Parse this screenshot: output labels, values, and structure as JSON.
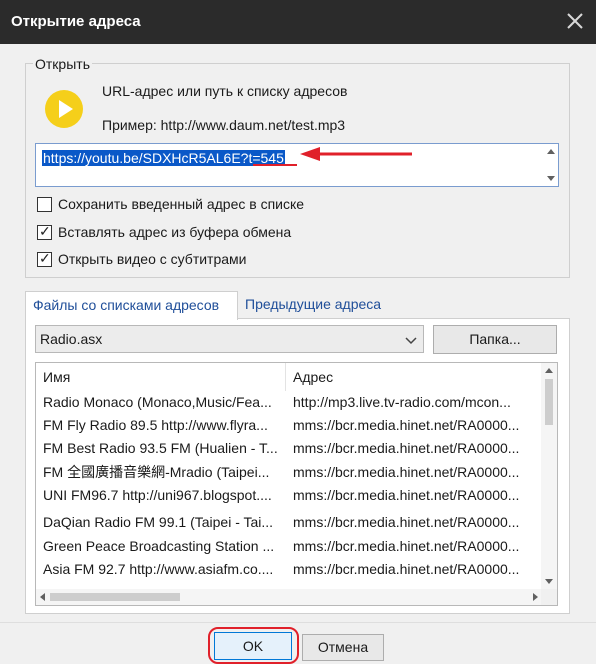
{
  "window": {
    "title": "Открытие адреса"
  },
  "open_group": {
    "label": "Открыть",
    "description": "URL-адрес или путь к списку адресов",
    "example": "Пример: http://www.daum.net/test.mp3",
    "url_value": "https://youtu.be/SDXHcR5AL6E?t=545"
  },
  "options": [
    {
      "label": "Сохранить введенный адрес в списке",
      "checked": false
    },
    {
      "label": "Вставлять адрес из буфера обмена",
      "checked": true
    },
    {
      "label": "Открыть видео с субтитрами",
      "checked": true
    }
  ],
  "tabs": [
    {
      "label": "Файлы со списками адресов",
      "active": true
    },
    {
      "label": "Предыдущие адреса",
      "active": false
    }
  ],
  "playlist": {
    "selected": "Radio.asx",
    "folder_button": "Папка..."
  },
  "list": {
    "columns": [
      "Имя",
      "Адрес"
    ],
    "rows": [
      {
        "name": "Radio Monaco (Monaco,Music/Fea...",
        "address": "http://mp3.live.tv-radio.com/mcon..."
      },
      {
        "name": "FM Fly Radio 89.5 http://www.flyra...",
        "address": "mms://bcr.media.hinet.net/RA0000..."
      },
      {
        "name": "FM Best Radio 93.5 FM (Hualien - T...",
        "address": "mms://bcr.media.hinet.net/RA0000..."
      },
      {
        "name": "FM 全國廣播音樂網-Mradio (Taipei...",
        "address": "mms://bcr.media.hinet.net/RA0000..."
      },
      {
        "name": "UNI FM96.7 http://uni967.blogspot....",
        "address": "mms://bcr.media.hinet.net/RA0000..."
      },
      {
        "name": "DaQian Radio FM 99.1 (Taipei - Tai...",
        "address": "mms://bcr.media.hinet.net/RA0000..."
      },
      {
        "name": "Green Peace Broadcasting Station ...",
        "address": "mms://bcr.media.hinet.net/RA0000..."
      },
      {
        "name": "Asia FM 92.7 http://www.asiafm.co....",
        "address": "mms://bcr.media.hinet.net/RA0000..."
      }
    ]
  },
  "footer": {
    "ok_label": "OK",
    "cancel_label": "Отмена"
  },
  "colors": {
    "annotation_red": "#e0202a",
    "selection_blue": "#0a58c8",
    "play_yellow": "#f5cf1a"
  },
  "icons": [
    "close-icon",
    "play-icon",
    "chevron-down-icon",
    "check-icon"
  ]
}
